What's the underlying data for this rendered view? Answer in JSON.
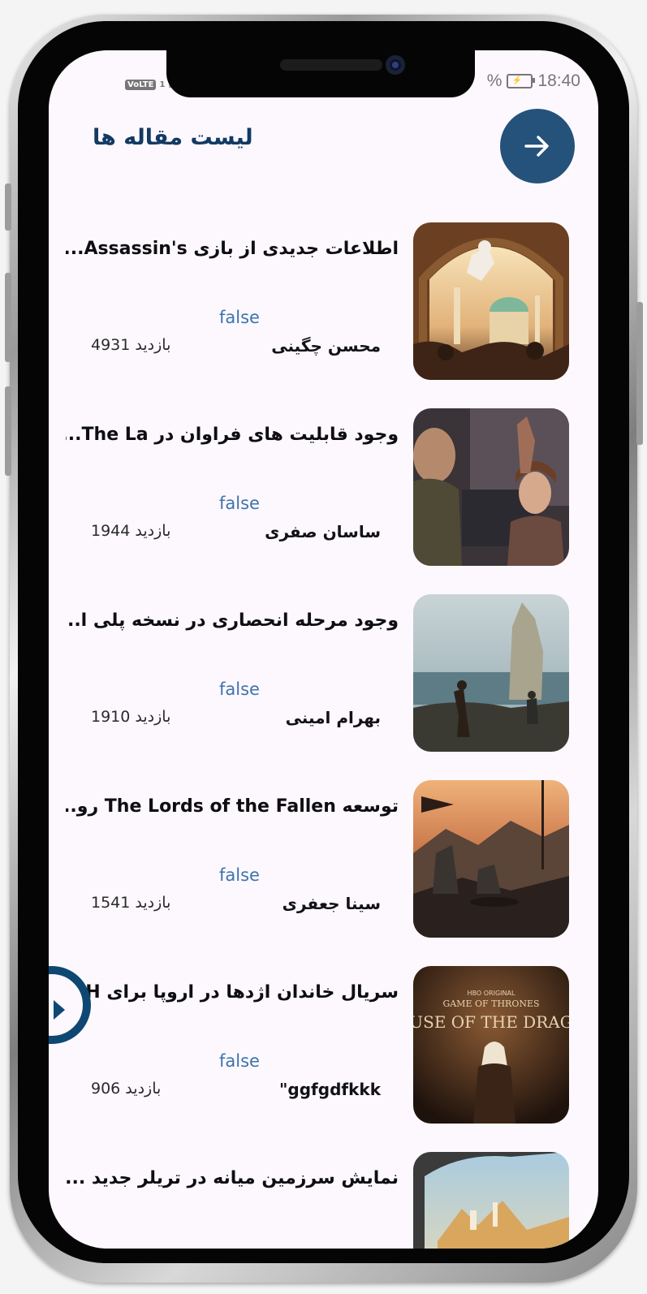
{
  "status_bar": {
    "volte": "VoLTE",
    "sim": "1",
    "battery_percent_glyph": "%",
    "time": "18:40"
  },
  "header": {
    "title": "لیست مقاله ها",
    "back_icon": "arrow-right-icon"
  },
  "articles": [
    {
      "title": "اطلاعات جدیدی از بازی Assassin's...",
      "flag": "false",
      "author": "محسن چگینی",
      "views": "بازدید 4931",
      "thumb_theme": "assassins-creed"
    },
    {
      "title": "وجود قابلیت های فراوان در The La...",
      "flag": "false",
      "author": "ساسان صفری",
      "views": "بازدید 1944",
      "thumb_theme": "the-last-of-us"
    },
    {
      "title": "وجود مرحله انحصاری در نسخه پلی ا...",
      "flag": "false",
      "author": "بهرام امینی",
      "views": "بازدید 1910",
      "thumb_theme": "coastal-ruins"
    },
    {
      "title": "توسعه The Lords of the Fallen رو...",
      "flag": "false",
      "author": "سینا جعفری",
      "views": "بازدید 1541",
      "thumb_theme": "lords-of-the-fallen"
    },
    {
      "title": "سریال خاندان اژدها در اروپا برای H...",
      "flag": "false",
      "author": "ggfgdfkkk\"",
      "views": "بازدید 906",
      "thumb_theme": "house-of-the-dragon"
    },
    {
      "title": "نمایش سرزمین میانه در تریلر جدید ...",
      "flag": "",
      "author": "",
      "views": "",
      "thumb_theme": "middle-earth"
    }
  ],
  "thumb_text": {
    "hbo": "HBO ORIGINAL",
    "got": "GAME OF THRONES",
    "hotd": "HOUSE OF THE DRAGON"
  },
  "colors": {
    "primary": "#24527a",
    "title_text": "#123a63",
    "flag_text": "#3e74ad",
    "screen_bg": "#fcf8fd"
  },
  "fab_icon": "play-icon"
}
